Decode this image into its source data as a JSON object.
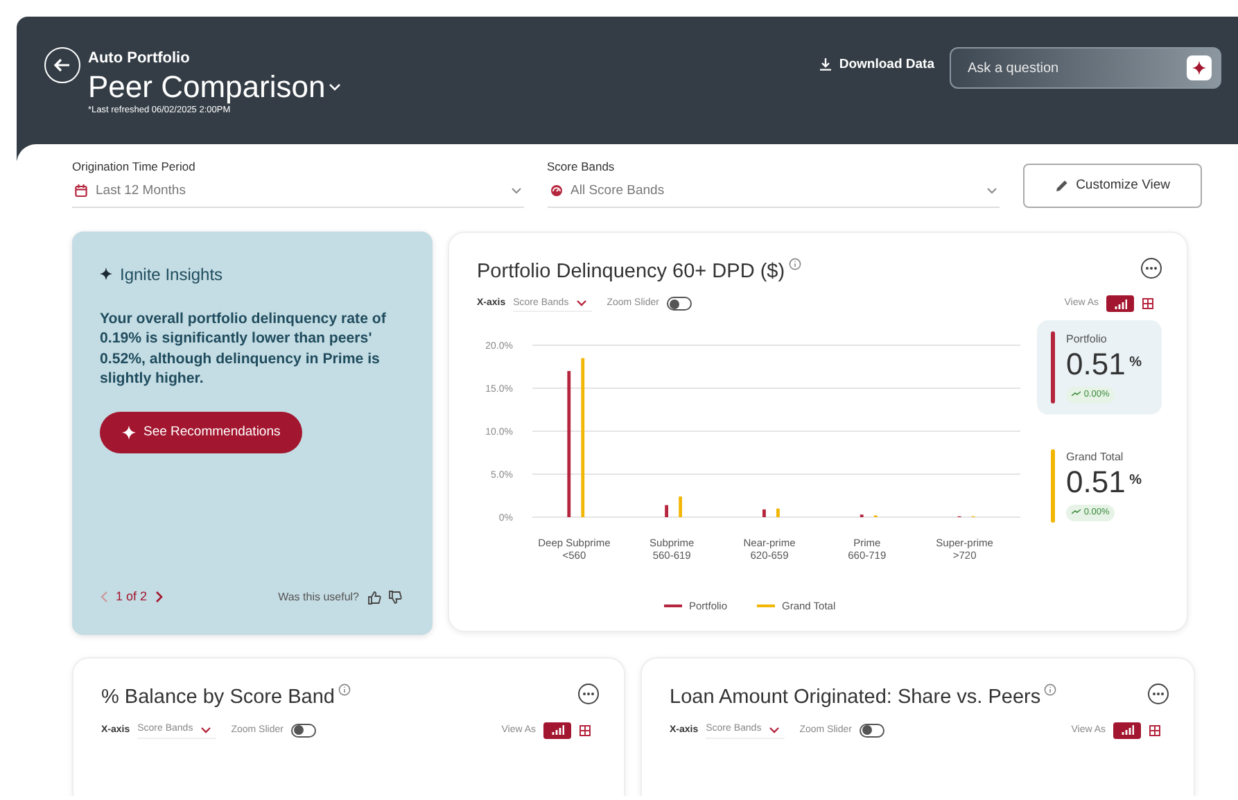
{
  "header": {
    "breadcrumb": "Auto Portfolio",
    "title": "Peer Comparison",
    "refreshed": "*Last refreshed 06/02/2025 2:00PM",
    "download": "Download Data",
    "ask": {
      "placeholder": "Ask a question"
    }
  },
  "filters": [
    {
      "label": "Origination Time Period",
      "value": "Last 12 Months",
      "kind": "calendar"
    },
    {
      "label": "Score Bands",
      "value": "All Score Bands",
      "kind": "gauge"
    }
  ],
  "customize": "Customize View",
  "insight": {
    "title": "Ignite Insights",
    "text": "Your overall portfolio delinquency rate of 0.19% is significantly lower than peers' 0.52%, although delinquency in Prime is slightly higher.",
    "button": "See Recommendations",
    "pager": "1 of 2",
    "feedback": "Was this useful?"
  },
  "main_chart": {
    "title": "Portfolio Delinquency 60+ DPD ($)",
    "xaxis_label": "X-axis",
    "xaxis_value": "Score Bands",
    "zoom_label": "Zoom Slider",
    "zoom_on": false,
    "view_as": "View As",
    "views": [
      {
        "kind": "bar",
        "selected": true
      },
      {
        "kind": "table",
        "selected": false
      }
    ],
    "chart_data": {
      "type": "bar",
      "categories": [
        "Deep Subprime\n<560",
        "Subprime\n560-619",
        "Near-prime\n620-659",
        "Prime\n660-719",
        "Super-prime\n>720"
      ],
      "series": [
        {
          "name": "Portfolio",
          "color": "#b5253d",
          "values": [
            17.0,
            1.4,
            0.9,
            0.3,
            0.1
          ]
        },
        {
          "name": "Grand Total",
          "color": "#f2b705",
          "values": [
            18.5,
            2.4,
            1.0,
            0.2,
            0.1
          ]
        }
      ],
      "grid": true,
      "legend": true,
      "ylim": [
        0,
        20
      ],
      "yticks": [
        {
          "value": 0,
          "label": "0%"
        },
        {
          "value": 5,
          "label": "5.0%"
        },
        {
          "value": 10,
          "label": "10.0%"
        },
        {
          "value": 15,
          "label": "15.0%"
        },
        {
          "value": 20,
          "label": "20.0%"
        }
      ]
    },
    "stats": [
      {
        "label": "Portfolio",
        "value": "0.51",
        "unit": "%",
        "change": "0.00%",
        "color": "#b5253d",
        "selected": true
      },
      {
        "label": "Grand Total",
        "value": "0.51",
        "unit": "%",
        "change": "0.00%",
        "color": "#f2b705",
        "selected": false
      }
    ]
  },
  "small_charts": [
    {
      "title": "% Balance by Score Band",
      "xaxis_label": "X-axis",
      "xaxis_value": "Score Bands",
      "zoom_label": "Zoom Slider",
      "zoom_on": false,
      "view_as": "View As",
      "views": [
        {
          "kind": "bar",
          "selected": true
        },
        {
          "kind": "table",
          "selected": false
        }
      ]
    },
    {
      "title": "Loan Amount Originated: Share vs. Peers",
      "xaxis_label": "X-axis",
      "xaxis_value": "Score Bands",
      "zoom_label": "Zoom Slider",
      "zoom_on": false,
      "view_as": "View As",
      "views": [
        {
          "kind": "bar",
          "selected": true
        },
        {
          "kind": "table",
          "selected": false
        }
      ]
    }
  ]
}
